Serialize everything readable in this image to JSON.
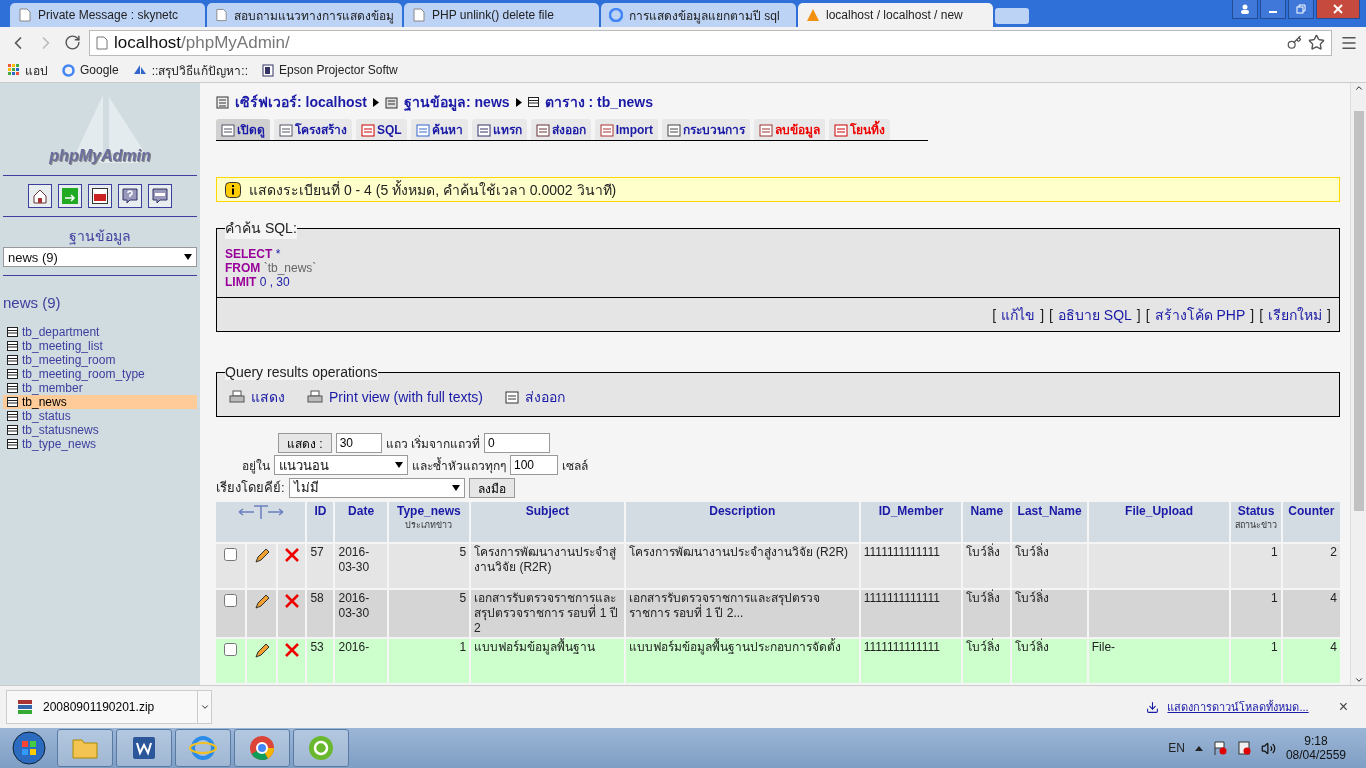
{
  "browser": {
    "tabs": [
      {
        "title": "Private Message : skynetc",
        "selected": false
      },
      {
        "title": "สอบถามแนวทางการแสดงข้อมู",
        "selected": false
      },
      {
        "title": "PHP unlink() delete file",
        "selected": false
      },
      {
        "title": "การแสดงข้อมูลแยกตามปี sql",
        "selected": false
      },
      {
        "title": "localhost / localhost / new",
        "selected": true
      }
    ],
    "address_host": "localhost",
    "address_path": "/phpMyAdmin/",
    "bookmarks": [
      "แอป",
      "Google",
      "::สรุปวิธีแก้ปัญหา::",
      "Epson Projector Softw"
    ]
  },
  "sidebar": {
    "logo": "phpMyAdmin",
    "database_label": "ฐานข้อมูล",
    "database_select": "news (9)",
    "database_heading": "news (9)",
    "tables": [
      {
        "name": "tb_department",
        "selected": false
      },
      {
        "name": "tb_meeting_list",
        "selected": false
      },
      {
        "name": "tb_meeting_room",
        "selected": false
      },
      {
        "name": "tb_meeting_room_type",
        "selected": false
      },
      {
        "name": "tb_member",
        "selected": false
      },
      {
        "name": "tb_news",
        "selected": true
      },
      {
        "name": "tb_status",
        "selected": false
      },
      {
        "name": "tb_statusnews",
        "selected": false
      },
      {
        "name": "tb_type_news",
        "selected": false
      }
    ]
  },
  "breadcrumb": [
    "เซิร์ฟเวอร์: localhost",
    "ฐานข้อมูล: news",
    "ตาราง : tb_news"
  ],
  "tabs": [
    {
      "label": "เปิดดู",
      "selected": true,
      "kind": "normal"
    },
    {
      "label": "โครงสร้าง",
      "selected": false,
      "kind": "normal"
    },
    {
      "label": "SQL",
      "selected": false,
      "kind": "normal"
    },
    {
      "label": "ค้นหา",
      "selected": false,
      "kind": "normal"
    },
    {
      "label": "แทรก",
      "selected": false,
      "kind": "normal"
    },
    {
      "label": "ส่งออก",
      "selected": false,
      "kind": "normal"
    },
    {
      "label": "Import",
      "selected": false,
      "kind": "normal"
    },
    {
      "label": "กระบวนการ",
      "selected": false,
      "kind": "normal"
    },
    {
      "label": "ลบข้อมูล",
      "selected": false,
      "kind": "danger"
    },
    {
      "label": "โยนทิ้ง",
      "selected": false,
      "kind": "danger"
    }
  ],
  "notice": "แสดงระเบียนที่ 0 - 4 (5 ทั้งหมด, คำค้นใช้เวลา 0.0002 วินาที)",
  "sql_box": {
    "legend": "คำค้น SQL:",
    "lines": [
      {
        "keyword": "SELECT",
        "rest": "*"
      },
      {
        "keyword": "FROM",
        "rest": "`tb_news`"
      },
      {
        "keyword": "LIMIT",
        "rest": "0 , 30"
      }
    ],
    "bracket_open": "[",
    "bracket_close": "]",
    "links": [
      "แก้ไข",
      "อธิบาย SQL",
      "สร้างโค้ด PHP",
      "เรียกใหม่"
    ]
  },
  "operations": {
    "legend": "Query results operations",
    "items": [
      "แสดง",
      "Print view (with full texts)",
      "ส่งออก"
    ]
  },
  "navigation": {
    "show_button": "แสดง :",
    "rows": "30",
    "rows_label": "แถว เริ่มจากแถวที่",
    "start": "0",
    "mode_label": "อยู่ใน",
    "mode": "แนวนอน",
    "repeat_label": "และซ้ำหัวแถวทุกๆ",
    "repeat": "100",
    "cells_label": "เซลล์",
    "sort_label": "เรียงโดยคีย์:",
    "sort": "ไม่มี",
    "go_button": "ลงมือ"
  },
  "table": {
    "columns": [
      {
        "label": "ID"
      },
      {
        "label": "Date"
      },
      {
        "label": "Type_news",
        "sub": "ประเภทข่าว"
      },
      {
        "label": "Subject"
      },
      {
        "label": "Description"
      },
      {
        "label": "ID_Member"
      },
      {
        "label": "Name"
      },
      {
        "label": "Last_Name"
      },
      {
        "label": "File_Upload"
      },
      {
        "label": "Status",
        "sub": "สถานะข่าว"
      },
      {
        "label": "Counter"
      }
    ],
    "rows": [
      {
        "checked": false,
        "highlighted": false,
        "cells": [
          "57",
          "2016-03-30",
          "5",
          "โครงการพัฒนางานประจำสู่งานวิจัย (R2R)",
          "โครงการพัฒนางานประจำสู่งานวิจัย (R2R)",
          "1111111111111",
          "โบว์ลิ่ง",
          "โบว์ลิ่ง",
          "",
          "1",
          "2"
        ]
      },
      {
        "checked": false,
        "highlighted": false,
        "cells": [
          "58",
          "2016-03-30",
          "5",
          "เอกสารรับตรวจราชการและสรุปตรวจราชการ รอบที่ 1 ปี 2",
          "เอกสารรับตรวจราชการและสรุปตรวจราชการ รอบที่ 1 ปี 2...",
          "1111111111111",
          "โบว์ลิ่ง",
          "โบว์ลิ่ง",
          "",
          "1",
          "4"
        ]
      },
      {
        "checked": false,
        "highlighted": true,
        "cells": [
          "53",
          "2016-",
          "1",
          "แบบฟอร์มข้อมูลพื้นฐาน",
          "แบบฟอร์มข้อมูลพื้นฐานประกอบการจัดตั้ง",
          "1111111111111",
          "โบว์ลิ่ง",
          "โบว์ลิ่ง",
          "File-",
          "1",
          "4"
        ]
      }
    ]
  },
  "download_bar": {
    "file": "20080901190201.zip",
    "show_all": "แสดงการดาวน์โหลดทั้งหมด...",
    "close": "×"
  },
  "taskbar": {
    "language": "EN",
    "time": "9:18",
    "date": "08/04/2559"
  }
}
